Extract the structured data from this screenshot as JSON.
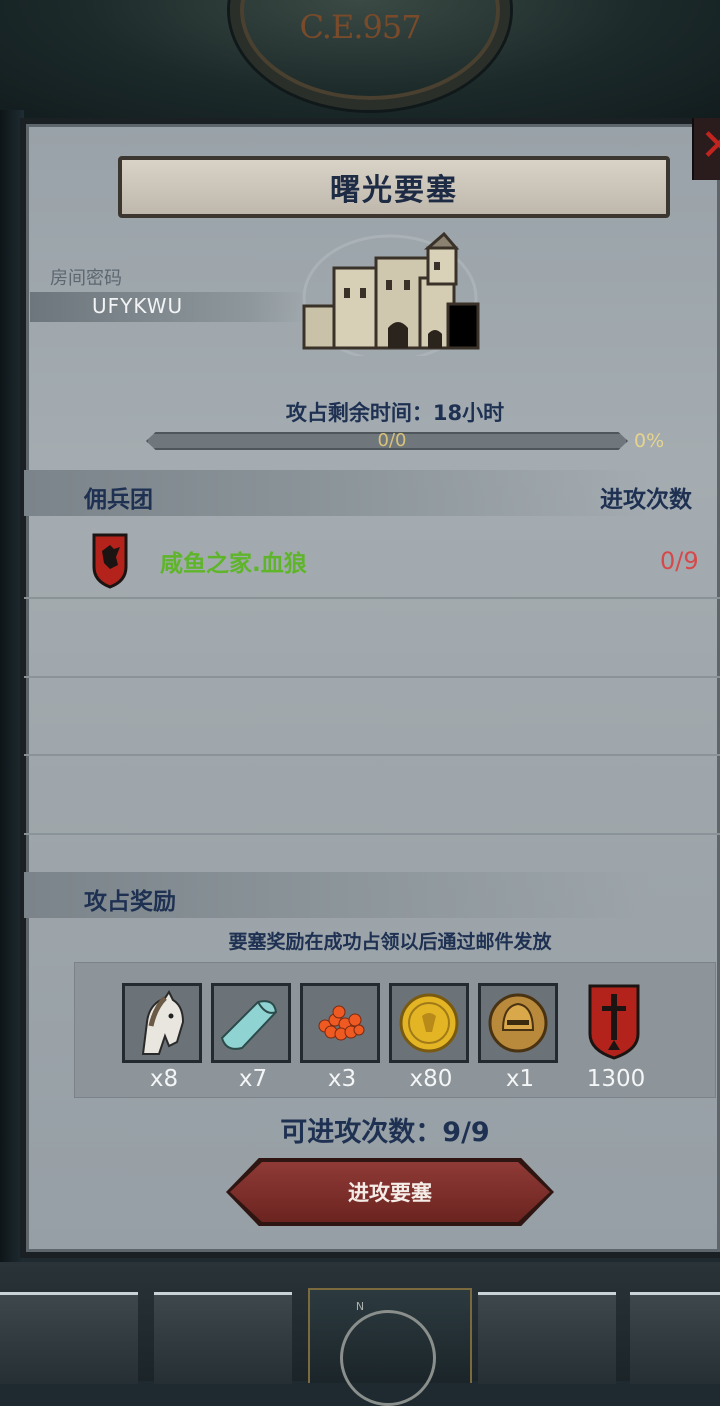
{
  "header": {
    "era": "C.E.957"
  },
  "fortress": {
    "title": "曙光要塞"
  },
  "room": {
    "label": "房间密码",
    "code": "UFYKWU"
  },
  "occupation": {
    "time_text": "攻占剩余时间：18小时",
    "progress_value": "0/0",
    "progress_percent": "0%",
    "progress_fraction": 0
  },
  "mercenaries": {
    "header": "佣兵团",
    "attacks_header": "进攻次数",
    "rows": [
      {
        "name": "咸鱼之家.血狼",
        "attacks": "0/9",
        "icon": "wolf-shield-icon"
      }
    ]
  },
  "rewards": {
    "header": "攻占奖励",
    "note": "要塞奖励在成功占领以后通过邮件发放",
    "items": [
      {
        "icon": "horse-icon",
        "qty": "x8"
      },
      {
        "icon": "cloth-icon",
        "qty": "x7"
      },
      {
        "icon": "berries-icon",
        "qty": "x3"
      },
      {
        "icon": "gold-coin-icon",
        "qty": "x80"
      },
      {
        "icon": "helmet-icon",
        "qty": "x1"
      },
      {
        "icon": "sword-banner-icon",
        "qty": "1300"
      }
    ]
  },
  "attack": {
    "count_text": "可进攻次数：9/9",
    "button_label": "进攻要塞"
  },
  "colors": {
    "title_text": "#1e2b44",
    "merc_name": "#5fb52a",
    "attack_count": "#d6494a",
    "button": "#8f3a36"
  }
}
